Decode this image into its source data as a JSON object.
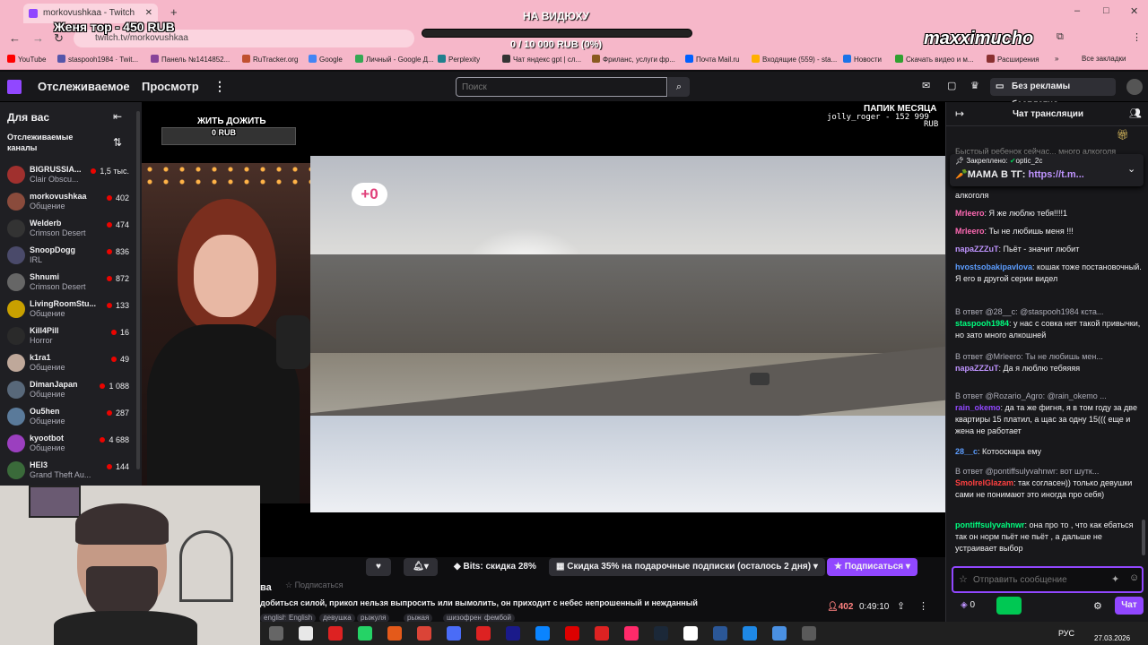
{
  "browser": {
    "tab_title": "morkovushkaa - Twitch",
    "url": "twitch.tv/morkovushkaa",
    "bookmarks": [
      "YouTube",
      "staspooh1984 · Twit...",
      "Панель №1414852...",
      "RuTracker.org",
      "Google",
      "Личный - Google Д...",
      "Perplexity",
      "Чат яндекс gpt | сл...",
      "Фриланс, услуги фр...",
      "Почта Mail.ru",
      "Входящие (559) - sta...",
      "Новости",
      "Скачать видео и м...",
      "Расширения"
    ],
    "all_bookmarks": "Все закладки",
    "overflow": "»"
  },
  "overlays": {
    "donor": "Женя тор - 450 RUB",
    "goal_title": "НА ВИДЮХУ",
    "goal_progress": "0 / 10 000 RUB (0%)",
    "goal_fraction": 0,
    "watermark": "maxximucho",
    "zhit_title": "ЖИТЬ ДОЖИТЬ",
    "zhit_value": "0 RUB",
    "papik_title": "ПАПИК МЕСЯЦА",
    "papik_user": "jolly_roger - 152 999",
    "papik_unit": "RUB",
    "plus_badge": "+0"
  },
  "nav": {
    "following": "Отслеживаемое",
    "browse": "Просмотр",
    "more": "⋮",
    "search_placeholder": "Поиск",
    "no_ads": "Без рекламы бесплатно"
  },
  "sidebar": {
    "title": "Для вас",
    "collapse": "⇤",
    "section": "Отслеживаемые каналы",
    "sort": "⇅",
    "channels": [
      {
        "name": "BIGRUSSIA...",
        "game": "Clair Obscu...",
        "viewers": "1,5 тыс.",
        "color": "#a0302e"
      },
      {
        "name": "morkovushkaa",
        "game": "Общение",
        "viewers": "402",
        "color": "#8a4b3c"
      },
      {
        "name": "Welderb",
        "game": "Crimson Desert",
        "viewers": "474",
        "color": "#333"
      },
      {
        "name": "SnoopDogg",
        "game": "IRL",
        "viewers": "836",
        "color": "#4a4a6a"
      },
      {
        "name": "Shnumi",
        "game": "Crimson Desert",
        "viewers": "872",
        "color": "#666"
      },
      {
        "name": "LivingRoomStu...",
        "game": "Общение",
        "viewers": "133",
        "color": "#c8a000"
      },
      {
        "name": "Kill4Pill",
        "game": "Horror",
        "viewers": "16",
        "color": "#2a2a2a"
      },
      {
        "name": "k1ra1",
        "game": "Общение",
        "viewers": "49",
        "color": "#bfa89a"
      },
      {
        "name": "DimanJapan",
        "game": "Общение",
        "viewers": "1 088",
        "color": "#58687a"
      },
      {
        "name": "Ou5hen",
        "game": "Общение",
        "viewers": "287",
        "color": "#5a7a9a"
      },
      {
        "name": "kyootbot",
        "game": "Общение",
        "viewers": "4 688",
        "color": "#9b3fbf"
      },
      {
        "name": "HEI3",
        "game": "Grand Theft Au...",
        "viewers": "144",
        "color": "#3a6a3a"
      }
    ]
  },
  "chat": {
    "header": "Чат трансляции",
    "pinned_label": "Закреплено:",
    "pinned_user": "optic_2c",
    "pinned_text": "🥕МАМА В ТГ: ",
    "pinned_link": "https://t.m...",
    "cut_top": "Быстрый ребенок сейчас... много алкоголя",
    "messages": [
      {
        "reply": "",
        "user": "",
        "color": "#efeff1",
        "text": "алкоголя"
      },
      {
        "reply": "",
        "user": "Mrleero",
        "color": "#ff69b4",
        "text": ": Я же люблю тебя!!!!1"
      },
      {
        "reply": "",
        "user": "Mrleero",
        "color": "#ff69b4",
        "text": ": Ты не любишь меня !!!"
      },
      {
        "reply": "",
        "user": "napaZZZuT",
        "color": "#bf94ff",
        "text": ": Пьёт - значит любит"
      },
      {
        "reply": "",
        "user": "hvostsobakipavlova",
        "color": "#5c9dff",
        "text": ": кошак тоже постановочный. Я его в другой серии видел"
      },
      {
        "reply": "В ответ @28__c: @staspooh1984 кста...",
        "user": "staspooh1984",
        "color": "#00ff7f",
        "text": ": у нас с совка нет такой привычки, но зато много алкошней"
      },
      {
        "reply": "В ответ @Mrleero: Ты не любишь мен...",
        "user": "napaZZZuT",
        "color": "#bf94ff",
        "text": ": Да я люблю тебяяяя"
      },
      {
        "reply": "В ответ @Rozario_Agro: @rain_okemo ...",
        "user": "rain_okemo",
        "color": "#9147ff",
        "text": ": да та же фигня, я в том году за две квартиры 15 платил, а щас за одну 15((( еще и жена не работает"
      },
      {
        "reply": "",
        "user": "28__c",
        "color": "#5c9dff",
        "text": ": Котооскара ему"
      },
      {
        "reply": "В ответ @pontiffsulyvahnwr: вот шутк...",
        "user": "SmoIrelGlazam",
        "color": "#ff4040",
        "text": ": так согласен)) только девушки сами не понимают это иногда про себя)"
      },
      {
        "reply": "",
        "user": "pontiffsulyvahnwr",
        "color": "#00ff7f",
        "text": ": она про то , что как ебаться так он норм пьёт не пьёт , а дальше не устраивает выбор"
      }
    ],
    "input_placeholder": "Отправить сообщение",
    "points": "0",
    "send": "Чат"
  },
  "stream": {
    "channel_fragment": "ва",
    "subscribe_grey": "Подписаться",
    "bits": "Bits: скидка 28%",
    "gift": "Скидка 35% на подарочные подписки (осталось 2 дня)",
    "subscribe": "Подписаться",
    "title": "добиться силой, прикол нельзя выпросить или вымолить, он приходит с небес непрошенный и нежданный",
    "tags": [
      "english",
      "English",
      "девушка",
      "рыжуля",
      "рыжая",
      "шизофрения",
      "фембой"
    ],
    "viewers": "402",
    "uptime": "0:49:10"
  },
  "taskbar": {
    "lang": "РУС",
    "date": "27.03.2026"
  },
  "colors": {
    "twitch_purple": "#9147ff",
    "browser_pink": "#f6b7c9",
    "live_red": "#eb0400"
  }
}
